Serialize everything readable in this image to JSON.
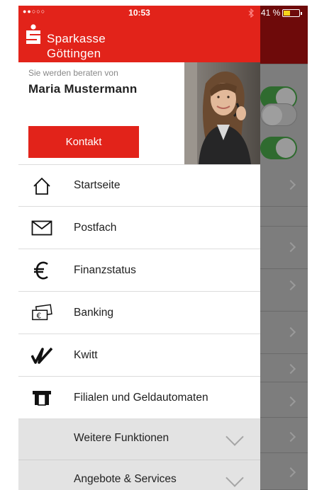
{
  "status_bar": {
    "signal": "●●○○○",
    "time": "10:53",
    "bluetooth_icon": "bluetooth-icon",
    "battery_percent": "41 %",
    "battery_level": 0.41,
    "battery_color": "#f7d51a"
  },
  "brand": {
    "line1": "Sparkasse",
    "line2": "Göttingen",
    "color": "#e2231a"
  },
  "advisor": {
    "caption": "Sie werden beraten von",
    "name": "Maria Mustermann",
    "contact_label": "Kontakt"
  },
  "menu": {
    "items": [
      {
        "label": "Startseite",
        "icon": "home-icon"
      },
      {
        "label": "Postfach",
        "icon": "mail-icon"
      },
      {
        "label": "Finanzstatus",
        "icon": "euro-icon"
      },
      {
        "label": "Banking",
        "icon": "banknotes-icon"
      },
      {
        "label": "Kwitt",
        "icon": "kwitt-icon"
      },
      {
        "label": "Filialen und Geldautomaten",
        "icon": "atm-icon"
      }
    ],
    "sections": [
      {
        "label": "Weitere Funktionen",
        "icon": "chevron-down-icon"
      },
      {
        "label": "Angebote & Services",
        "icon": "chevron-down-icon"
      }
    ]
  }
}
